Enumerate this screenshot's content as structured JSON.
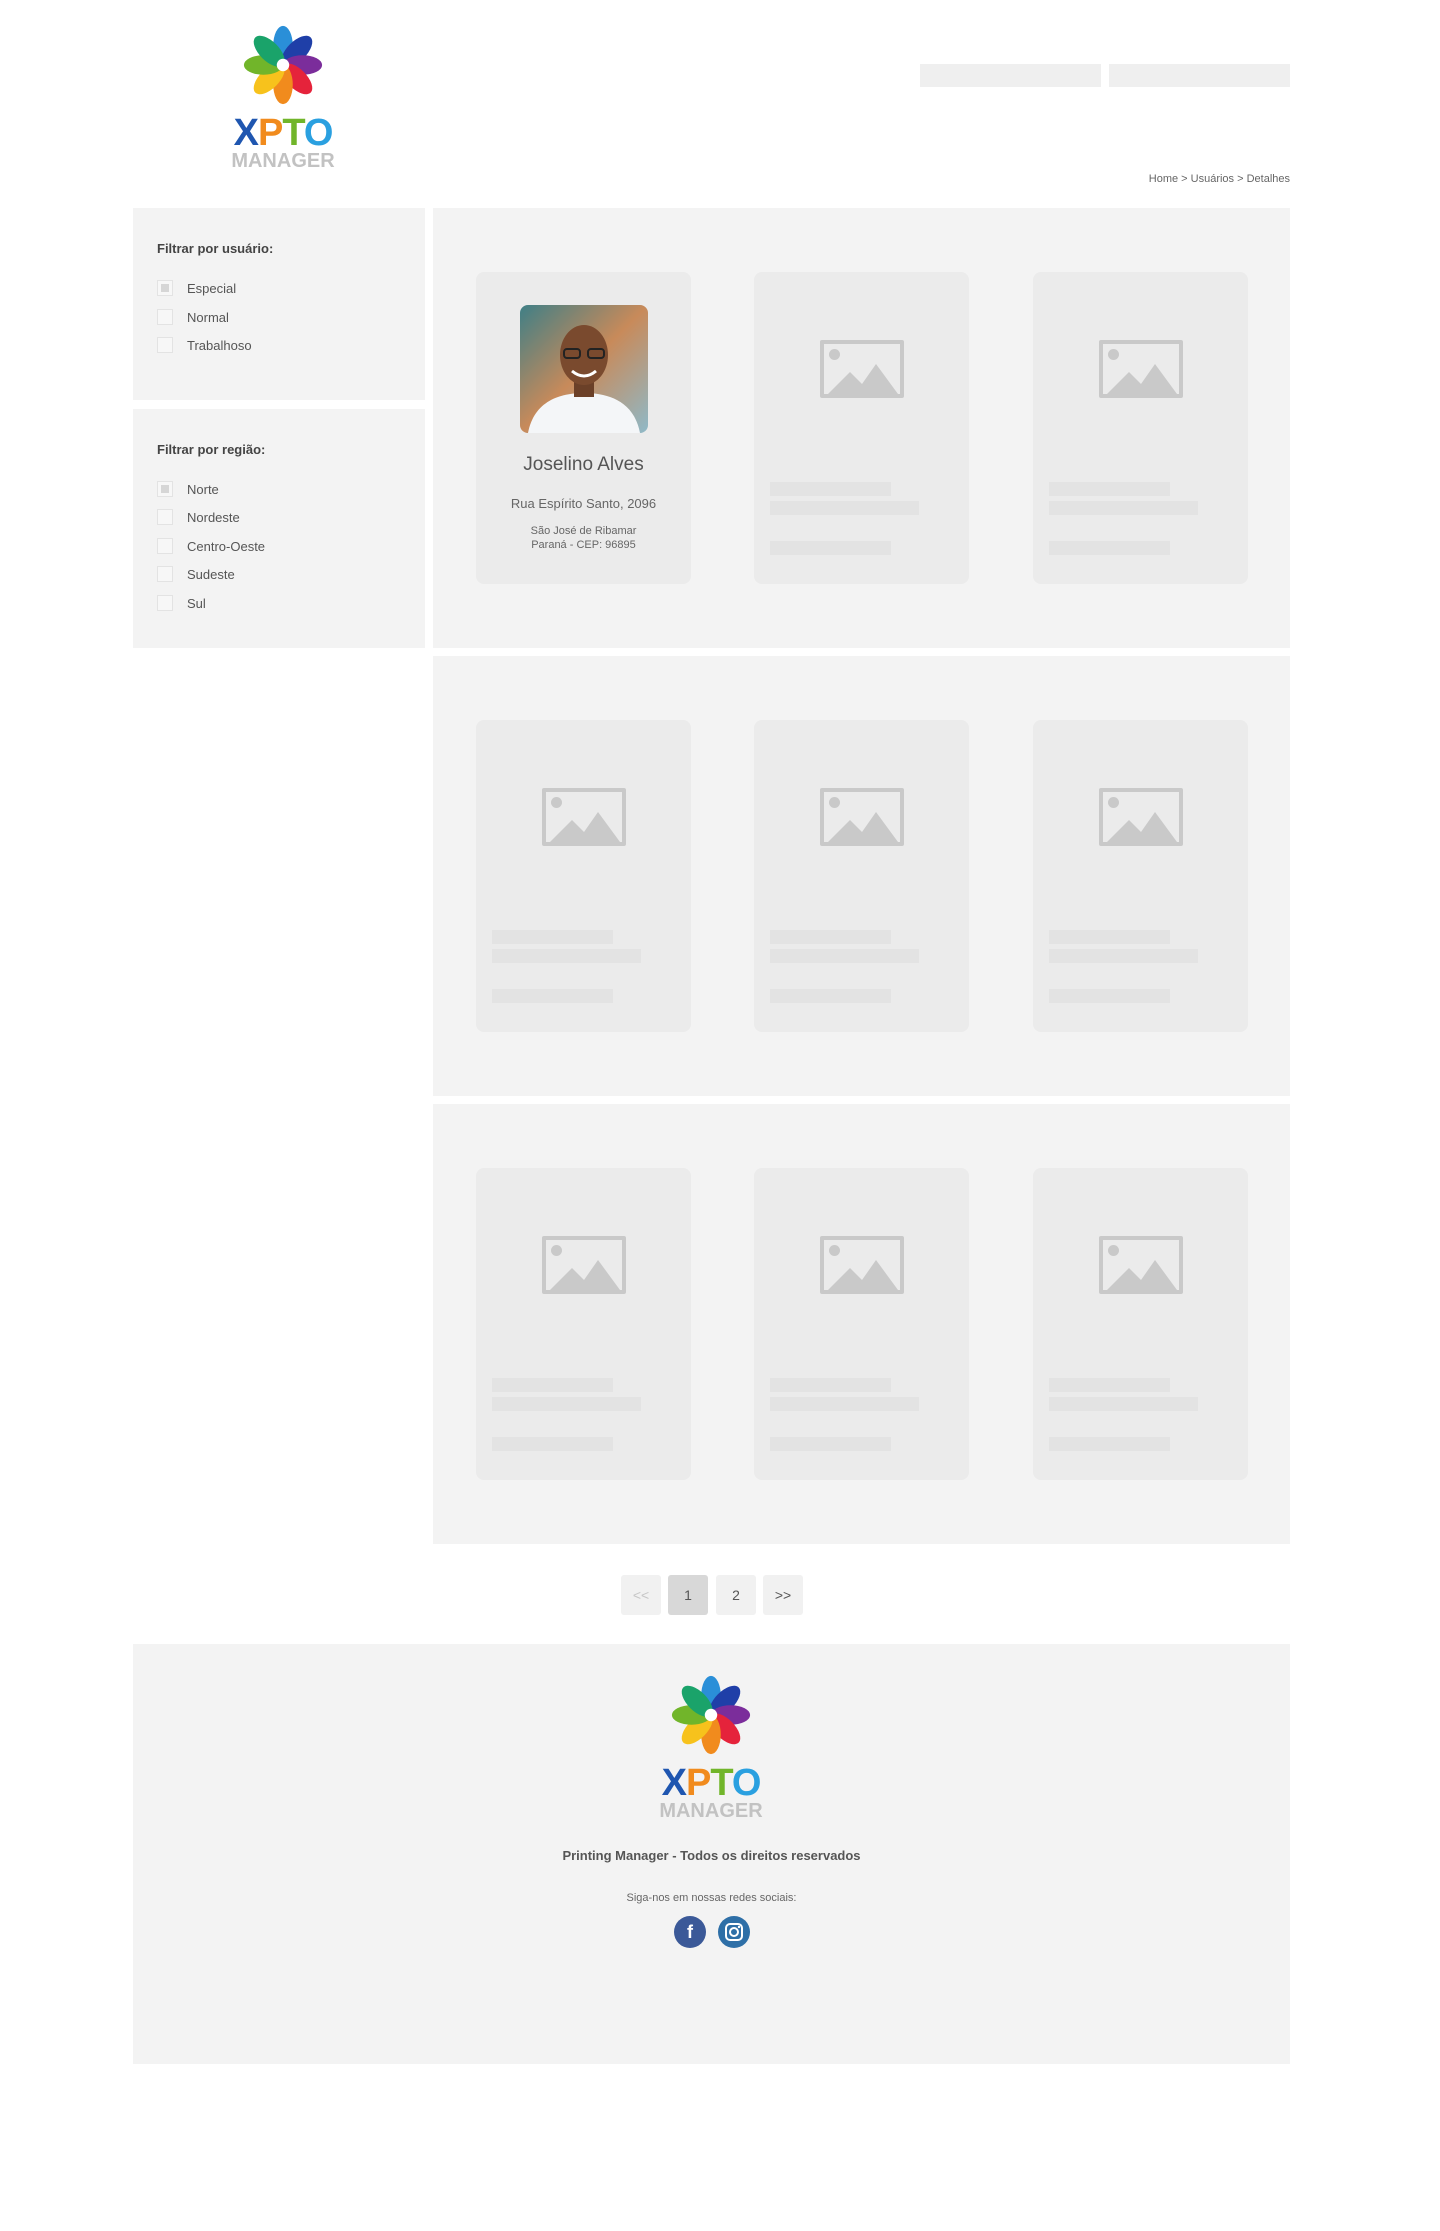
{
  "brand": {
    "logo_top": "XPTO",
    "logo_bottom": "MANAGER",
    "logo_letters": [
      "X",
      "P",
      "T",
      "O"
    ]
  },
  "header": {
    "buttons": [
      "",
      ""
    ]
  },
  "breadcrumb": {
    "text": "Home > Usuários > Detalhes"
  },
  "filters": {
    "user": {
      "title": "Filtrar por usuário:",
      "options": [
        {
          "label": "Especial",
          "checked": true
        },
        {
          "label": "Normal",
          "checked": false
        },
        {
          "label": "Trabalhoso",
          "checked": false
        }
      ]
    },
    "region": {
      "title": "Filtrar por região:",
      "options": [
        {
          "label": "Norte",
          "checked": true
        },
        {
          "label": "Nordeste",
          "checked": false
        },
        {
          "label": "Centro-Oeste",
          "checked": false
        },
        {
          "label": "Sudeste",
          "checked": false
        },
        {
          "label": "Sul",
          "checked": false
        }
      ]
    }
  },
  "user_card": {
    "name": "Joselino Alves",
    "street": "Rua Espírito Santo, 2096",
    "city": "São José de Ribamar",
    "state_cep": "Paraná - CEP: 96895"
  },
  "pagination": {
    "prev": "<<",
    "pages": [
      "1",
      "2"
    ],
    "next": ">>",
    "active": "1"
  },
  "footer": {
    "copyright": "Printing Manager - Todos os direitos reservados",
    "social_text": "Siga-nos em nossas redes sociais:",
    "social_icons": [
      "facebook-icon",
      "instagram-icon"
    ],
    "colors": {
      "facebook": "#3b5998",
      "instagram": "#2e6fa7"
    }
  },
  "colors": {
    "panel": "#f3f3f3",
    "card": "#ebebeb",
    "placeholder": "#c9c9c9"
  }
}
